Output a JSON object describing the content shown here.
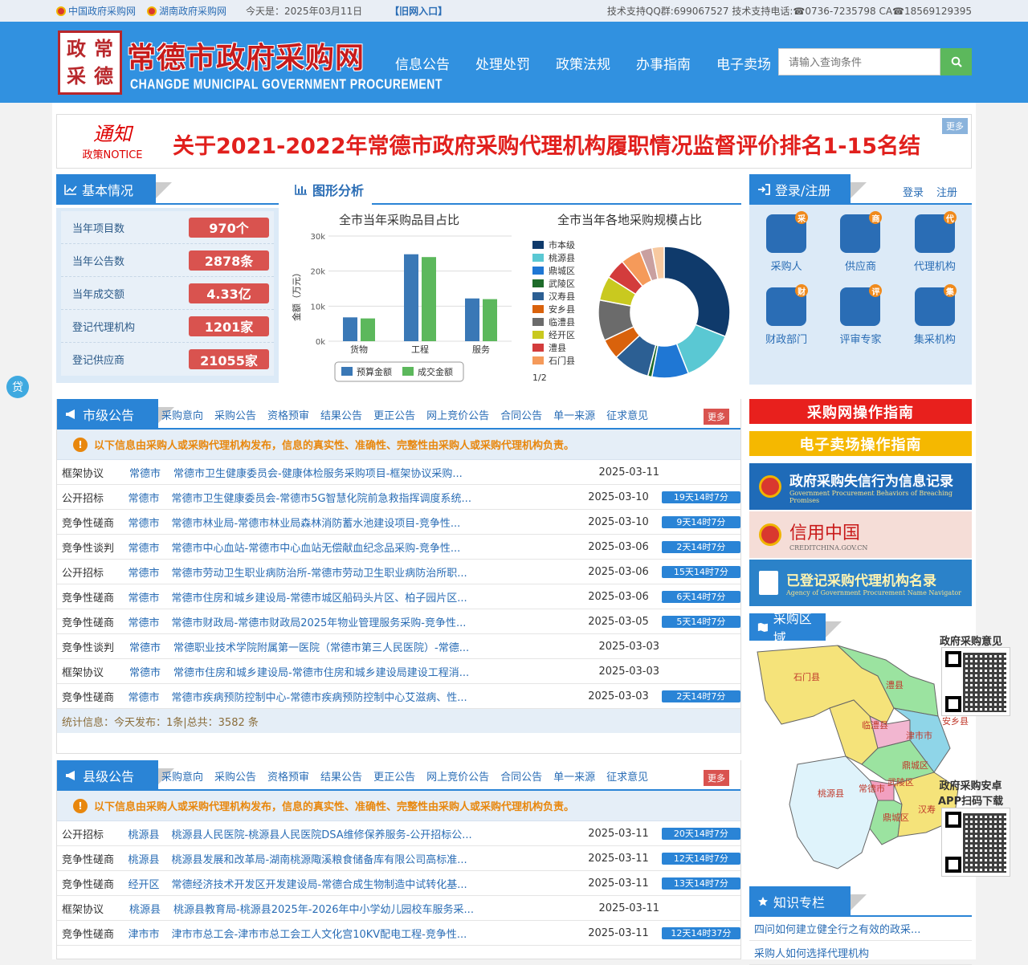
{
  "topbar": {
    "link1": "中国政府采购网",
    "link2": "湖南政府采购网",
    "today": "今天是：2025年03月11日",
    "old": "【旧网入口】",
    "support": "技术支持QQ群:699067527 技术支持电话:☎0736-7235798 CA☎18569129395"
  },
  "header": {
    "seal": [
      "政",
      "常",
      "采",
      "德"
    ],
    "title": "常德市政府采购网",
    "subtitle": "CHANGDE MUNICIPAL GOVERNMENT PROCUREMENT",
    "nav": [
      "信息公告",
      "处理处罚",
      "政策法规",
      "办事指南",
      "电子卖场"
    ],
    "search_placeholder": "请输入查询条件"
  },
  "notice": {
    "icon_big": "通知",
    "icon_small": "政策NOTICE",
    "text": "关于2021-2022年常德市政府采购代理机构履职情况监督评价排名1-15名结",
    "more": "更多"
  },
  "basic": {
    "title": "基本情况",
    "rows": [
      {
        "label": "当年项目数",
        "value": "970个"
      },
      {
        "label": "当年公告数",
        "value": "2878条"
      },
      {
        "label": "当年成交额",
        "value": "4.33亿"
      },
      {
        "label": "登记代理机构",
        "value": "1201家"
      },
      {
        "label": "登记供应商",
        "value": "21055家"
      }
    ]
  },
  "chart_panel": {
    "title": "图形分析",
    "pager": "1/2"
  },
  "chart_data": [
    {
      "type": "bar",
      "title": "全市当年采购品目占比",
      "ylabel": "金额（万元）",
      "categories": [
        "货物",
        "工程",
        "服务"
      ],
      "ylim": [
        0,
        30000
      ],
      "yticks": [
        "0k",
        "10k",
        "20k",
        "30k"
      ],
      "series": [
        {
          "name": "预算金额",
          "color": "#3a78b6",
          "values": [
            6800,
            24800,
            12200
          ]
        },
        {
          "name": "成交金额",
          "color": "#5cb85c",
          "values": [
            6500,
            24000,
            12000
          ]
        }
      ]
    },
    {
      "type": "pie",
      "title": "全市当年各地采购规模占比",
      "labels": [
        "市本级",
        "桃源县",
        "鼎城区",
        "武陵区",
        "汉寿县",
        "安乡县",
        "临澧县",
        "经开区",
        "澧县",
        "石门县"
      ],
      "colors": [
        "#0f3a6b",
        "#5ac8d3",
        "#1f77d4",
        "#1e6b2a",
        "#2c5f93",
        "#d9620c",
        "#6b6b6b",
        "#c9c91f",
        "#d33c3c",
        "#f59a5a"
      ],
      "values": [
        31,
        13,
        9,
        1,
        9,
        5,
        10,
        6,
        5,
        5
      ],
      "extra": [
        {
          "color": "#c9a0a0",
          "value": 3
        },
        {
          "color": "#f7c9a0",
          "value": 3
        }
      ]
    }
  ],
  "login": {
    "title": "登录/注册",
    "login": "登录",
    "register": "注册",
    "items": [
      {
        "label": "采购人",
        "badge": "采"
      },
      {
        "label": "供应商",
        "badge": "商"
      },
      {
        "label": "代理机构",
        "badge": "代"
      },
      {
        "label": "财政部门",
        "badge": "财"
      },
      {
        "label": "评审专家",
        "badge": "评"
      },
      {
        "label": "集采机构",
        "badge": "集"
      }
    ]
  },
  "city": {
    "title": "市级公告",
    "cats": [
      "采购意向",
      "采购公告",
      "资格预审",
      "结果公告",
      "更正公告",
      "网上竞价公告",
      "合同公告",
      "单一来源",
      "征求意见"
    ],
    "more": "更多",
    "warn": "以下信息由采购人或采购代理机构发布，信息的真实性、准确性、完整性由采购人或采购代理机构负责。",
    "rows": [
      {
        "type": "框架协议",
        "region": "常德市",
        "name": "常德市卫生健康委员会-健康体检服务采购项目-框架协议采购...",
        "date": "2025-03-11",
        "count": ""
      },
      {
        "type": "公开招标",
        "region": "常德市",
        "name": "常德市卫生健康委员会-常德市5G智慧化院前急救指挥调度系统...",
        "date": "2025-03-10",
        "count": "19天14时7分"
      },
      {
        "type": "竞争性磋商",
        "region": "常德市",
        "name": "常德市林业局-常德市林业局森林消防蓄水池建设项目-竞争性...",
        "date": "2025-03-10",
        "count": "9天14时7分"
      },
      {
        "type": "竞争性谈判",
        "region": "常德市",
        "name": "常德市中心血站-常德市中心血站无偿献血纪念品采购-竞争性...",
        "date": "2025-03-06",
        "count": "2天14时7分"
      },
      {
        "type": "公开招标",
        "region": "常德市",
        "name": "常德市劳动卫生职业病防治所-常德市劳动卫生职业病防治所职...",
        "date": "2025-03-06",
        "count": "15天14时7分"
      },
      {
        "type": "竞争性磋商",
        "region": "常德市",
        "name": "常德市住房和城乡建设局-常德市城区船码头片区、柏子园片区...",
        "date": "2025-03-06",
        "count": "6天14时7分"
      },
      {
        "type": "竞争性磋商",
        "region": "常德市",
        "name": "常德市财政局-常德市财政局2025年物业管理服务采购-竞争性...",
        "date": "2025-03-05",
        "count": "5天14时7分"
      },
      {
        "type": "竞争性谈判",
        "region": "常德市",
        "name": "常德职业技术学院附属第一医院（常德市第三人民医院）-常德...",
        "date": "2025-03-03",
        "count": ""
      },
      {
        "type": "框架协议",
        "region": "常德市",
        "name": "常德市住房和城乡建设局-常德市住房和城乡建设局建设工程消...",
        "date": "2025-03-03",
        "count": ""
      },
      {
        "type": "竞争性磋商",
        "region": "常德市",
        "name": "常德市疾病预防控制中心-常德市疾病预防控制中心艾滋病、性...",
        "date": "2025-03-03",
        "count": "2天14时7分"
      }
    ],
    "stat": "统计信息：今天发布：1条|总共：3582 条"
  },
  "county": {
    "title": "县级公告",
    "cats": [
      "采购意向",
      "采购公告",
      "资格预审",
      "结果公告",
      "更正公告",
      "网上竞价公告",
      "合同公告",
      "单一来源",
      "征求意见"
    ],
    "more": "更多",
    "warn": "以下信息由采购人或采购代理机构发布，信息的真实性、准确性、完整性由采购人或采购代理机构负责。",
    "rows": [
      {
        "type": "公开招标",
        "region": "桃源县",
        "name": "桃源县人民医院-桃源县人民医院DSA维修保养服务-公开招标公...",
        "date": "2025-03-11",
        "count": "20天14时7分"
      },
      {
        "type": "竞争性磋商",
        "region": "桃源县",
        "name": "桃源县发展和改革局-湖南桃源陬溪粮食储备库有限公司高标准...",
        "date": "2025-03-11",
        "count": "12天14时7分"
      },
      {
        "type": "竞争性磋商",
        "region": "经开区",
        "name": "常德经济技术开发区开发建设局-常德合成生物制造中试转化基...",
        "date": "2025-03-11",
        "count": "13天14时7分"
      },
      {
        "type": "框架协议",
        "region": "桃源县",
        "name": "桃源县教育局-桃源县2025年-2026年中小学幼儿园校车服务采...",
        "date": "2025-03-11",
        "count": ""
      },
      {
        "type": "竞争性磋商",
        "region": "津市市",
        "name": "津市市总工会-津市市总工会工人文化宫10KV配电工程-竞争性...",
        "date": "2025-03-11",
        "count": "12天14时37分"
      }
    ]
  },
  "side": {
    "guide1": "采购网操作指南",
    "guide2": "电子卖场操作指南",
    "banner1": "政府采购失信行为信息记录",
    "banner1_en": "Government Procurement Behaviors of Breaching Promises",
    "banner2": "信用中国",
    "banner2_en": "CREDITCHINA.GOV.CN",
    "banner3": "已登记采购代理机构名录",
    "banner3_en": "Agency of Government Procurement Name Navigator"
  },
  "area": {
    "title": "采购区域",
    "labels": [
      "石门县",
      "澧县",
      "临澧县",
      "津市市",
      "安乡县",
      "鼎城区",
      "武陵区",
      "常德市",
      "桃源县",
      "鼎城区",
      "汉寿"
    ]
  },
  "qr": {
    "label1": "政府采购意见",
    "label2a": "政府采购安卓",
    "label2b": "APP扫码下载"
  },
  "knowledge": {
    "title": "知识专栏",
    "items": [
      "四问如何建立健全行之有效的政采...",
      "采购人如何选择代理机构"
    ]
  },
  "float_label": "贷"
}
